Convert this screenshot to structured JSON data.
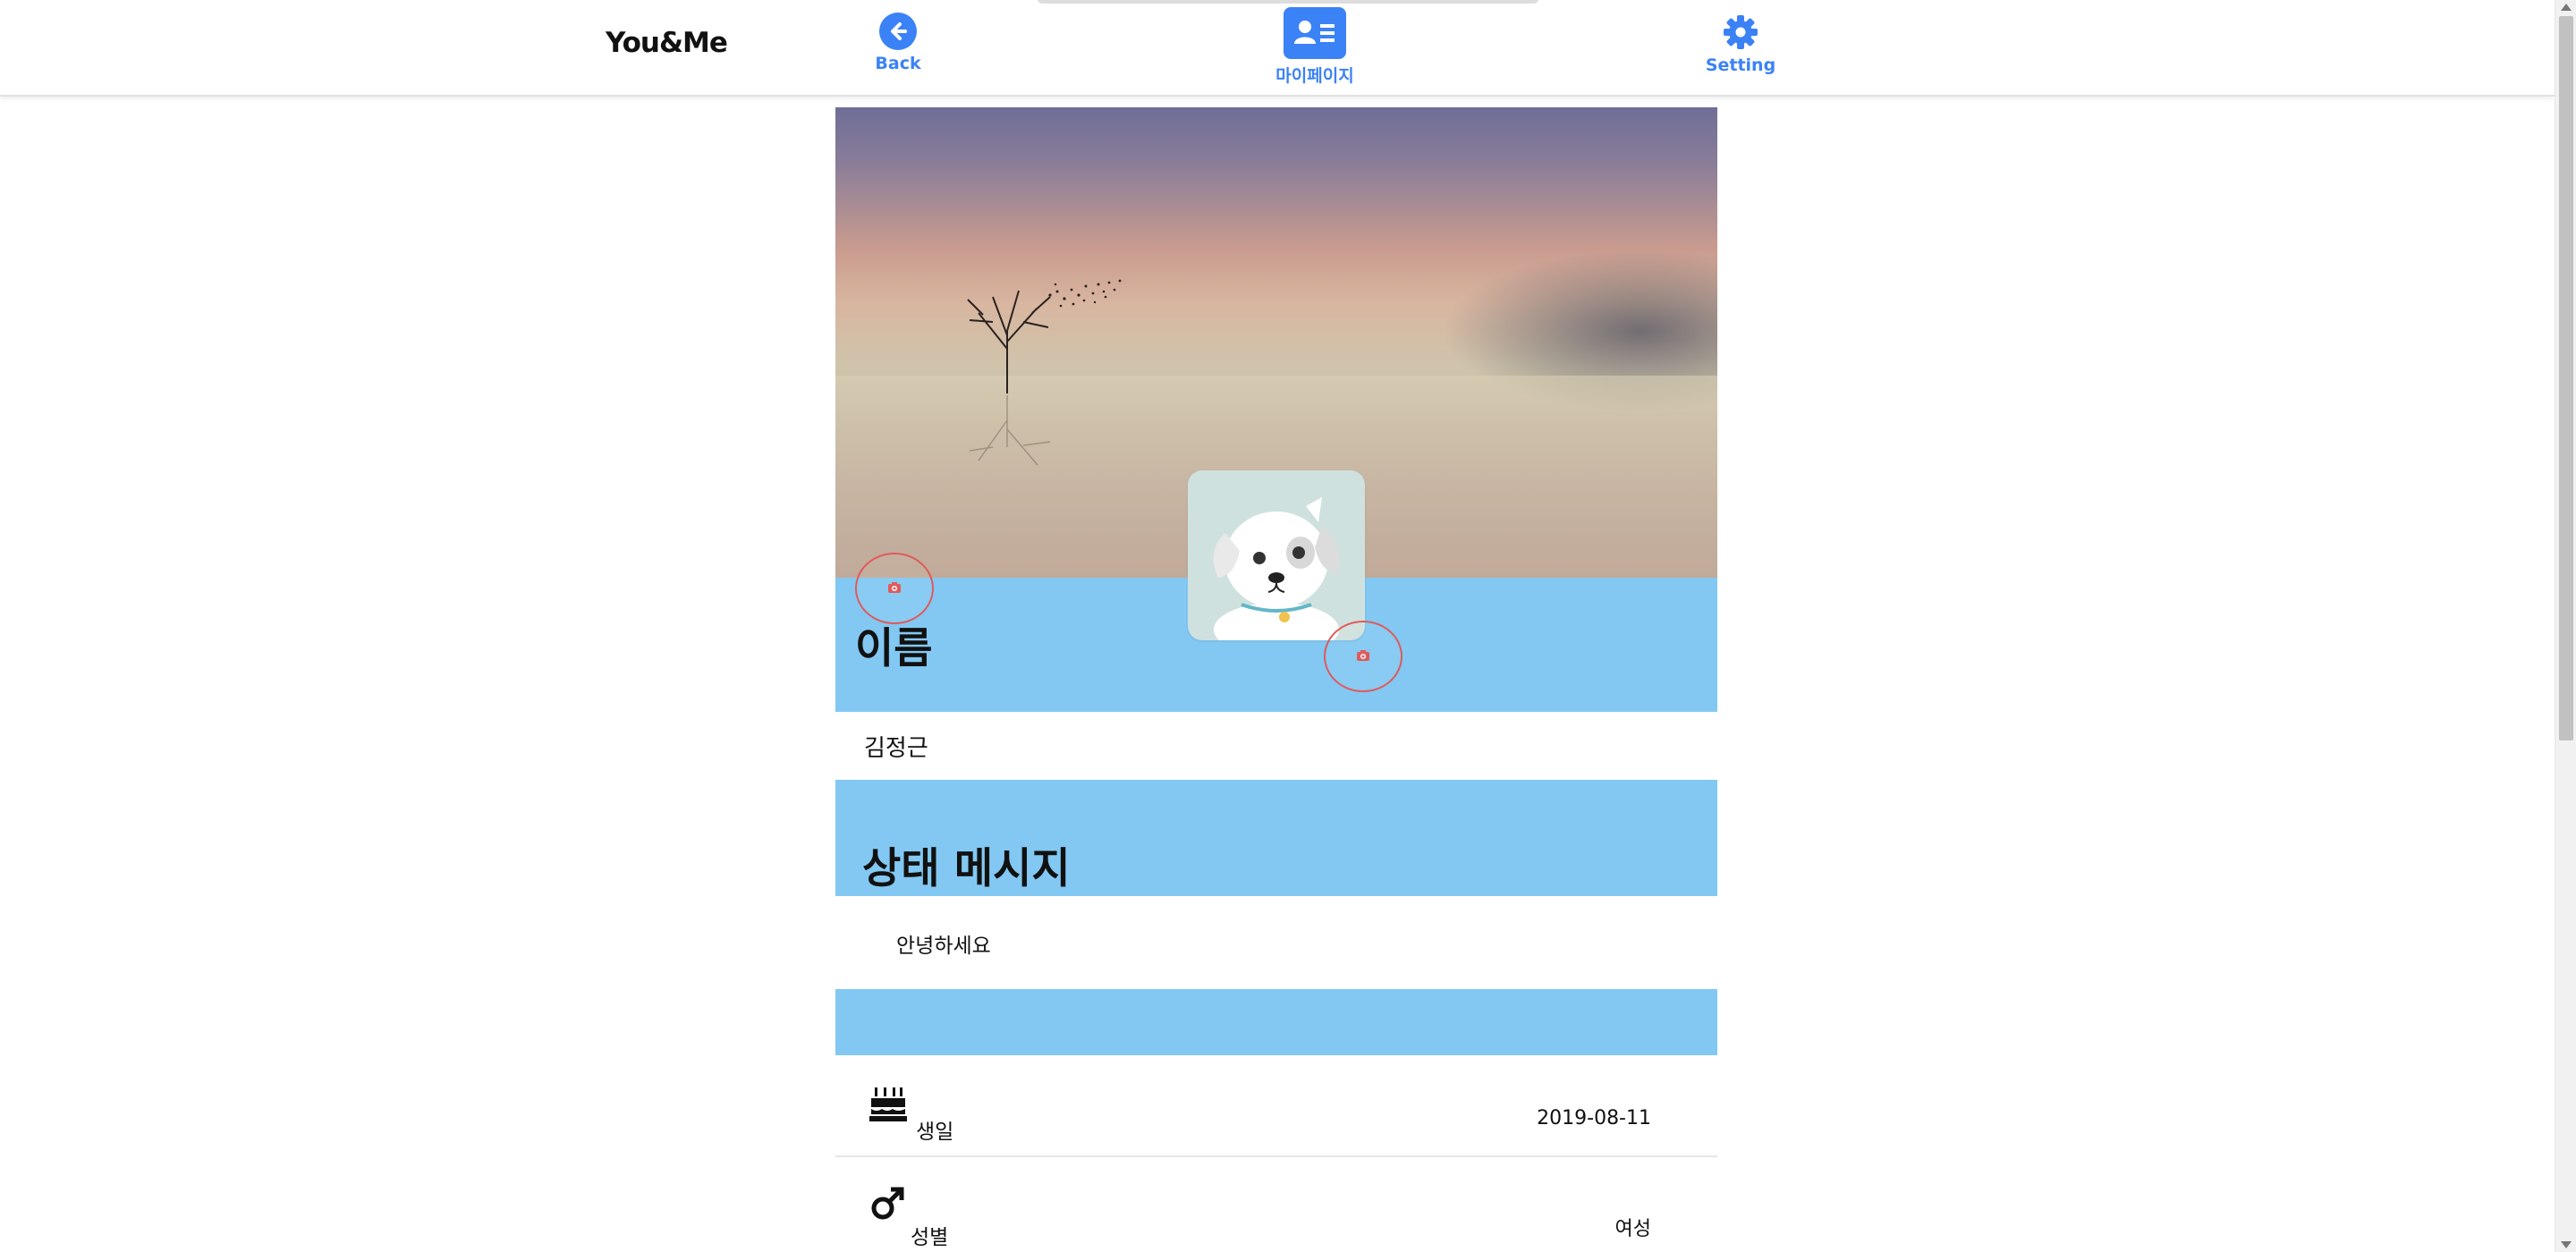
{
  "nav": {
    "brand": "You&Me",
    "back_label": "Back",
    "mypage_label": "마이페이지",
    "setting_label": "Setting",
    "back_icon": "arrow-left-circle-icon",
    "mypage_icon": "id-card-icon",
    "setting_icon": "gear-icon"
  },
  "profile": {
    "name_heading": "이름",
    "name_value": "김정근",
    "status_heading": "상태 메시지",
    "status_value": "안녕하세요",
    "birthday_label": "생일",
    "birthday_value": "2019-08-11",
    "gender_label": "성별",
    "gender_value": "여성",
    "cover_camera_icon": "camera-icon",
    "avatar_camera_icon": "camera-icon",
    "birthday_icon": "birthday-cake-icon",
    "gender_icon": "mars-icon"
  },
  "colors": {
    "accent": "#3b82f6",
    "band": "#82c8f3",
    "camera_ring": "#e05a5a"
  }
}
